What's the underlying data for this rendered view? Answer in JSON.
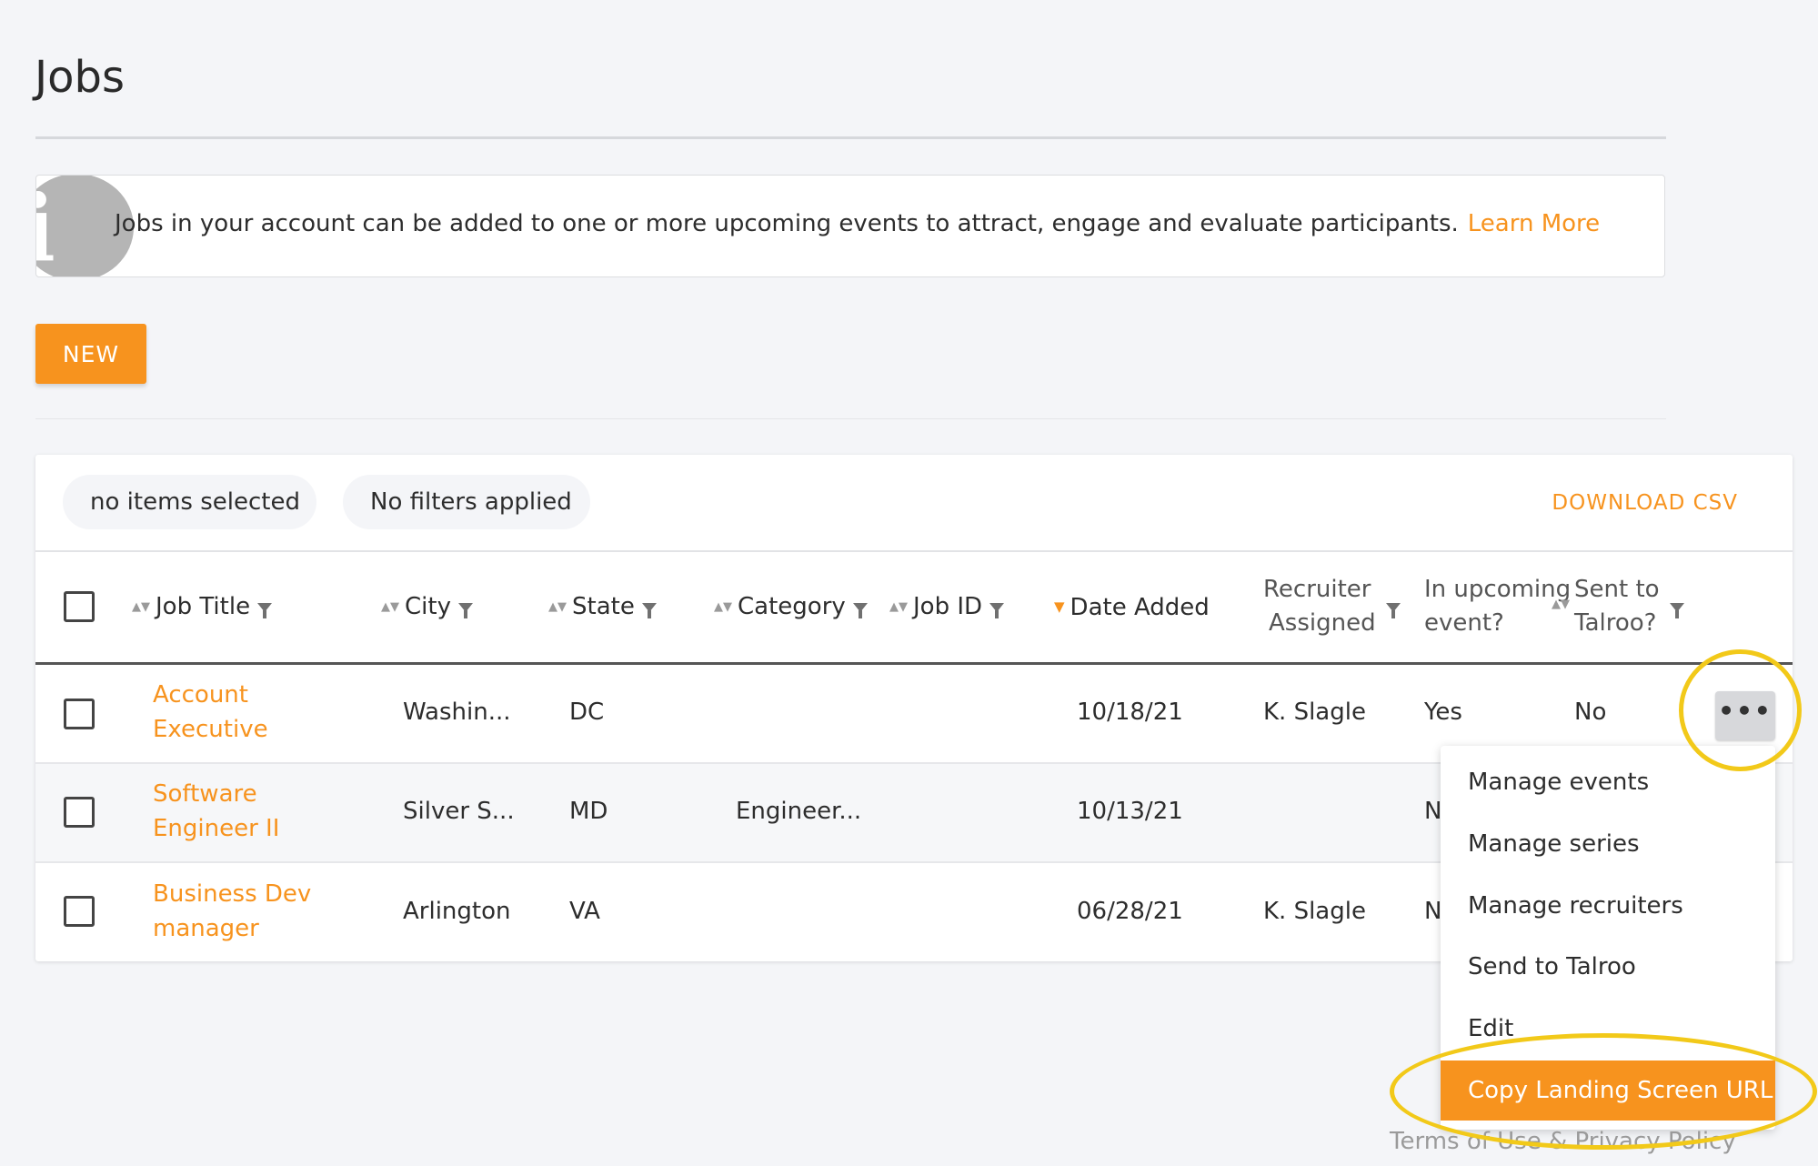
{
  "page": {
    "title": "Jobs"
  },
  "info": {
    "text": "Jobs in your account can be added to one or more upcoming events to attract, engage and evaluate participants.",
    "link": "Learn More"
  },
  "actions": {
    "new_label": "NEW"
  },
  "toolbar": {
    "selection": "no items selected",
    "filters": "No filters applied",
    "download": "DOWNLOAD CSV"
  },
  "table": {
    "columns": {
      "job_title": "Job Title",
      "city": "City",
      "state": "State",
      "category": "Category",
      "job_id": "Job ID",
      "date_added": "Date Added",
      "recruiter_1": "Recruiter",
      "recruiter_2": "Assigned",
      "upcoming_1": "In upcoming",
      "upcoming_2": "event?",
      "talroo_1": "Sent to",
      "talroo_2": "Talroo?"
    },
    "rows": [
      {
        "title_1": "Account",
        "title_2": "Executive",
        "city": "Washin...",
        "state": "DC",
        "category": "",
        "job_id": "",
        "date": "10/18/21",
        "recruiter": "K. Slagle",
        "upcoming": "Yes",
        "talroo": "No"
      },
      {
        "title_1": "Software",
        "title_2": "Engineer II",
        "city": "Silver S...",
        "state": "MD",
        "category": "Engineer...",
        "job_id": "",
        "date": "10/13/21",
        "recruiter": "",
        "upcoming": "N",
        "talroo": ""
      },
      {
        "title_1": "Business Dev",
        "title_2": "manager",
        "city": "Arlington",
        "state": "VA",
        "category": "",
        "job_id": "",
        "date": "06/28/21",
        "recruiter": "K. Slagle",
        "upcoming": "N",
        "talroo": ""
      }
    ]
  },
  "row_menu": {
    "trigger": "•••",
    "items": [
      "Manage events",
      "Manage series",
      "Manage recruiters",
      "Send to Talroo",
      "Edit",
      "Copy Landing Screen URL"
    ]
  },
  "footer": {
    "text": "Terms of Use & Privacy Policy"
  },
  "colors": {
    "accent": "#f7931e",
    "highlight_ring": "#f2c919",
    "background": "#f4f5f8"
  }
}
